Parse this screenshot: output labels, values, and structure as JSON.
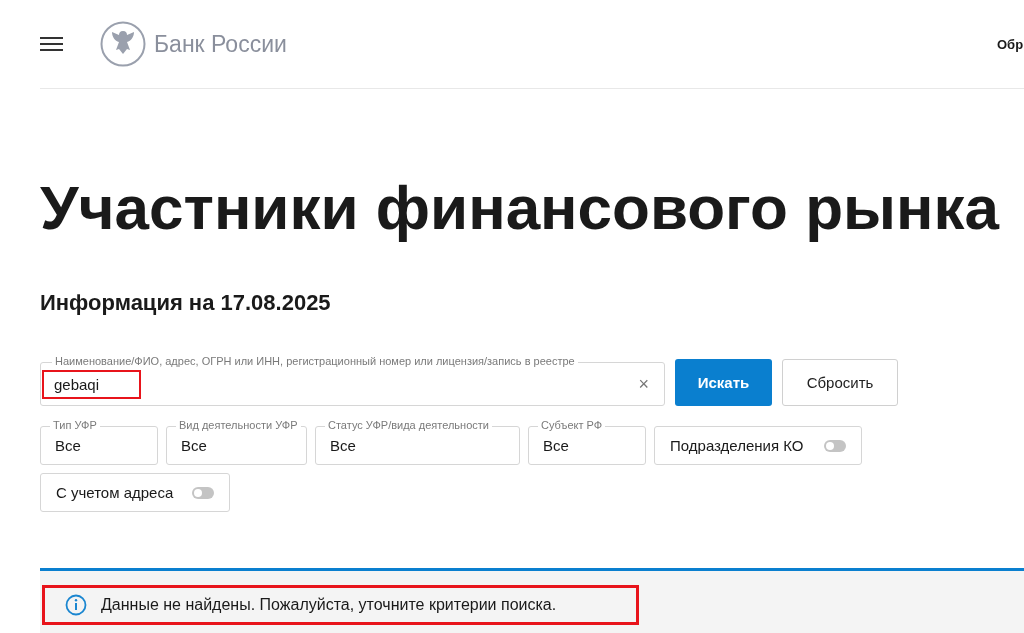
{
  "header": {
    "logo_text": "Банк России",
    "nav_cut": "Обр"
  },
  "page_title": "Участники финансового рынка",
  "info_date": "Информация на 17.08.2025",
  "search": {
    "label": "Наименование/ФИО, адрес, ОГРН или ИНН, регистрационный номер или лицензия/запись в реестре",
    "value": "gebaqi",
    "clear": "×",
    "highlighted": true
  },
  "buttons": [
    {
      "label": "Искать",
      "kind": "primary"
    },
    {
      "label": "Сбросить",
      "kind": "secondary"
    }
  ],
  "filters": [
    {
      "kind": "select",
      "label": "Тип УФР",
      "value": "Все"
    },
    {
      "kind": "select",
      "label": "Вид деятельности УФР",
      "value": "Все"
    },
    {
      "kind": "select",
      "label": "Статус УФР/вида деятельности",
      "value": "Все"
    },
    {
      "kind": "select",
      "label": "Субъект РФ",
      "value": "Все"
    },
    {
      "kind": "toggle",
      "label": "Подразделения КО",
      "on": false
    },
    {
      "kind": "toggle",
      "label": "С учетом адреса",
      "on": false
    }
  ],
  "message": {
    "text": "Данные не найдены. Пожалуйста, уточните критерии поиска.",
    "highlighted": true
  }
}
